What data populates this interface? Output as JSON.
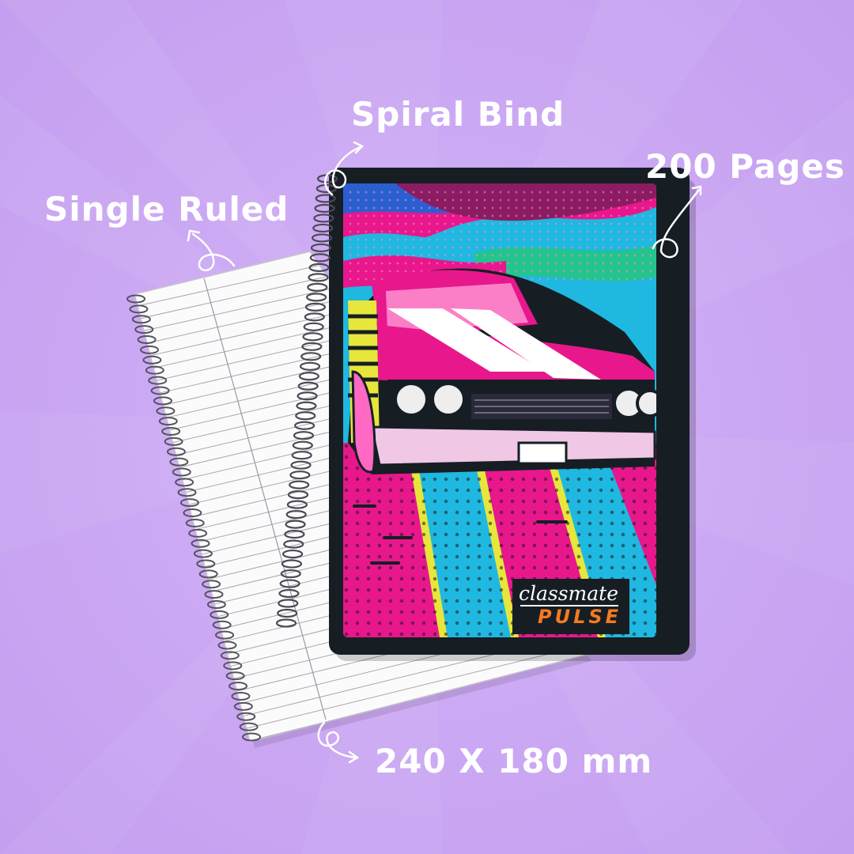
{
  "labels": {
    "spiral_bind": "Spiral Bind",
    "pages": "200 Pages",
    "ruling": "Single Ruled",
    "size": "240 X 180 mm"
  },
  "brand": {
    "name": "classmate",
    "line": "PULSE"
  },
  "colors": {
    "background": "#c8a4f2",
    "label_text": "#ffffff",
    "cover_dark": "#161e24",
    "accent_magenta": "#e8178c",
    "accent_cyan": "#1fb8e0",
    "accent_yellow": "#e7e63a",
    "brand_orange": "#f57a1f"
  }
}
